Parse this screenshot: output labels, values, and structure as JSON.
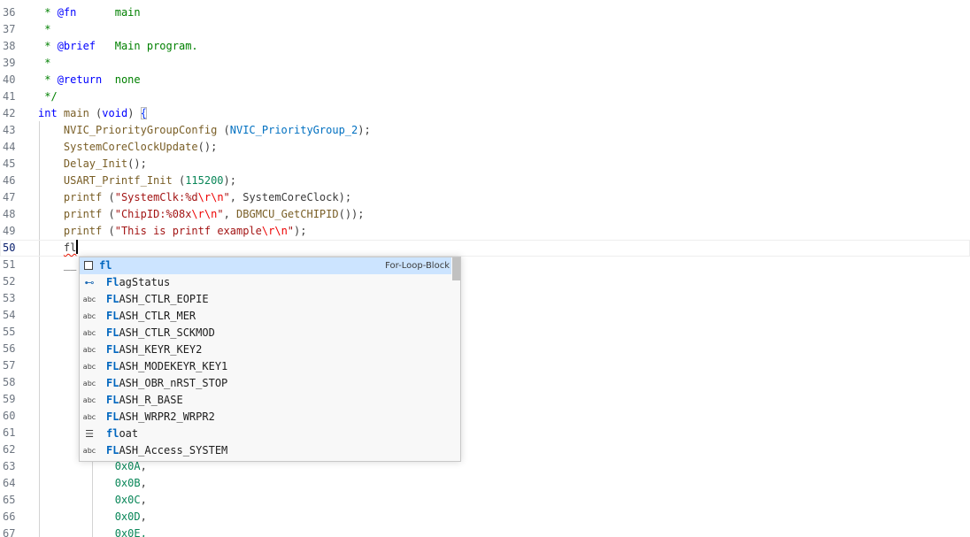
{
  "editor": {
    "lines": [
      {
        "n": "36",
        "tokens": [
          [
            " * ",
            "comment"
          ],
          [
            "@fn",
            "doctag"
          ],
          [
            "      main",
            "comment"
          ]
        ]
      },
      {
        "n": "37",
        "tokens": [
          [
            " *",
            "comment"
          ]
        ]
      },
      {
        "n": "38",
        "tokens": [
          [
            " * ",
            "comment"
          ],
          [
            "@brief",
            "doctag"
          ],
          [
            "   Main program.",
            "comment"
          ]
        ]
      },
      {
        "n": "39",
        "tokens": [
          [
            " *",
            "comment"
          ]
        ]
      },
      {
        "n": "40",
        "tokens": [
          [
            " * ",
            "comment"
          ],
          [
            "@return",
            "doctag"
          ],
          [
            "  none",
            "comment"
          ]
        ]
      },
      {
        "n": "41",
        "tokens": [
          [
            " */",
            "comment"
          ]
        ]
      },
      {
        "n": "42",
        "tokens": [
          [
            "int",
            "keyword"
          ],
          [
            " ",
            "plain"
          ],
          [
            "main",
            "func"
          ],
          [
            " (",
            "plain"
          ],
          [
            "void",
            "keyword"
          ],
          [
            ") ",
            "plain"
          ],
          [
            "{",
            "brace"
          ]
        ]
      },
      {
        "n": "43",
        "tokens": [
          [
            "    ",
            "plain"
          ],
          [
            "NVIC_PriorityGroupConfig",
            "func"
          ],
          [
            " (",
            "plain"
          ],
          [
            "NVIC_PriorityGroup_2",
            "macro"
          ],
          [
            ");",
            "plain"
          ]
        ]
      },
      {
        "n": "44",
        "tokens": [
          [
            "    ",
            "plain"
          ],
          [
            "SystemCoreClockUpdate",
            "func"
          ],
          [
            "();",
            "plain"
          ]
        ]
      },
      {
        "n": "45",
        "tokens": [
          [
            "    ",
            "plain"
          ],
          [
            "Delay_Init",
            "func"
          ],
          [
            "();",
            "plain"
          ]
        ]
      },
      {
        "n": "46",
        "tokens": [
          [
            "    ",
            "plain"
          ],
          [
            "USART_Printf_Init",
            "func"
          ],
          [
            " (",
            "plain"
          ],
          [
            "115200",
            "number"
          ],
          [
            ");",
            "plain"
          ]
        ]
      },
      {
        "n": "47",
        "tokens": [
          [
            "    ",
            "plain"
          ],
          [
            "printf",
            "func"
          ],
          [
            " (",
            "plain"
          ],
          [
            "\"SystemClk:%d",
            "string"
          ],
          [
            "\\r\\n",
            "escape"
          ],
          [
            "\"",
            "string"
          ],
          [
            ", SystemCoreClock);",
            "plain"
          ]
        ]
      },
      {
        "n": "48",
        "tokens": [
          [
            "    ",
            "plain"
          ],
          [
            "printf",
            "func"
          ],
          [
            " (",
            "plain"
          ],
          [
            "\"ChipID:%08x",
            "string"
          ],
          [
            "\\r\\n",
            "escape"
          ],
          [
            "\"",
            "string"
          ],
          [
            ", ",
            "plain"
          ],
          [
            "DBGMCU_GetCHIPID",
            "func"
          ],
          [
            "());",
            "plain"
          ]
        ]
      },
      {
        "n": "49",
        "tokens": [
          [
            "    ",
            "plain"
          ],
          [
            "printf",
            "func"
          ],
          [
            " (",
            "plain"
          ],
          [
            "\"This is printf example",
            "string"
          ],
          [
            "\\r\\n",
            "escape"
          ],
          [
            "\"",
            "string"
          ],
          [
            ");",
            "plain"
          ]
        ]
      },
      {
        "n": "50",
        "tokens": [
          [
            "    ",
            "plain"
          ],
          [
            "fl",
            "squiggle"
          ],
          [
            "",
            "cursor"
          ]
        ],
        "current": true
      },
      {
        "n": "51",
        "tokens": [
          [
            "    ",
            "plain"
          ],
          [
            "__",
            "plain"
          ]
        ]
      },
      {
        "n": "52",
        "tokens": []
      },
      {
        "n": "53",
        "tokens": []
      },
      {
        "n": "54",
        "tokens": []
      },
      {
        "n": "55",
        "tokens": []
      },
      {
        "n": "56",
        "tokens": []
      },
      {
        "n": "57",
        "tokens": []
      },
      {
        "n": "58",
        "tokens": []
      },
      {
        "n": "59",
        "tokens": []
      },
      {
        "n": "60",
        "tokens": []
      },
      {
        "n": "61",
        "tokens": []
      },
      {
        "n": "62",
        "tokens": []
      },
      {
        "n": "63",
        "tokens": [
          [
            "            ",
            "plain"
          ],
          [
            "0x0A",
            "number"
          ],
          [
            ",",
            "plain"
          ]
        ]
      },
      {
        "n": "64",
        "tokens": [
          [
            "            ",
            "plain"
          ],
          [
            "0x0B",
            "number"
          ],
          [
            ",",
            "plain"
          ]
        ]
      },
      {
        "n": "65",
        "tokens": [
          [
            "            ",
            "plain"
          ],
          [
            "0x0C",
            "number"
          ],
          [
            ",",
            "plain"
          ]
        ]
      },
      {
        "n": "66",
        "tokens": [
          [
            "            ",
            "plain"
          ],
          [
            "0x0D",
            "number"
          ],
          [
            ",",
            "plain"
          ]
        ]
      },
      {
        "n": "67",
        "tokens": [
          [
            "            ",
            "plain"
          ],
          [
            "0x0E,",
            "number"
          ]
        ]
      }
    ]
  },
  "suggest": {
    "typed_prefix": "fl",
    "items": [
      {
        "prefix": "fl",
        "rest": "",
        "icon": "snippet-icon",
        "detail": "For-Loop-Block",
        "selected": true
      },
      {
        "prefix": "Fl",
        "rest": "agStatus",
        "icon": "struct-icon",
        "glyph": "⊷"
      },
      {
        "prefix": "FL",
        "rest": "ASH_CTLR_EOPIE",
        "icon": "text-icon",
        "glyph": "abc"
      },
      {
        "prefix": "FL",
        "rest": "ASH_CTLR_MER",
        "icon": "text-icon",
        "glyph": "abc"
      },
      {
        "prefix": "FL",
        "rest": "ASH_CTLR_SCKMOD",
        "icon": "text-icon",
        "glyph": "abc"
      },
      {
        "prefix": "FL",
        "rest": "ASH_KEYR_KEY2",
        "icon": "text-icon",
        "glyph": "abc"
      },
      {
        "prefix": "FL",
        "rest": "ASH_MODEKEYR_KEY1",
        "icon": "text-icon",
        "glyph": "abc"
      },
      {
        "prefix": "FL",
        "rest": "ASH_OBR_nRST_STOP",
        "icon": "text-icon",
        "glyph": "abc"
      },
      {
        "prefix": "FL",
        "rest": "ASH_R_BASE",
        "icon": "text-icon",
        "glyph": "abc"
      },
      {
        "prefix": "FL",
        "rest": "ASH_WRPR2_WRPR2",
        "icon": "text-icon",
        "glyph": "abc"
      },
      {
        "prefix": "fl",
        "rest": "oat",
        "icon": "keyword-icon",
        "glyph": "☰"
      },
      {
        "prefix": "FL",
        "rest": "ASH_Access_SYSTEM",
        "icon": "text-icon",
        "glyph": "abc"
      }
    ]
  },
  "colors": {
    "selection": "#cce4ff",
    "match_highlight": "#0066bf",
    "comment": "#008000",
    "keyword": "#0000ff",
    "function": "#795e26",
    "string": "#a31515"
  }
}
